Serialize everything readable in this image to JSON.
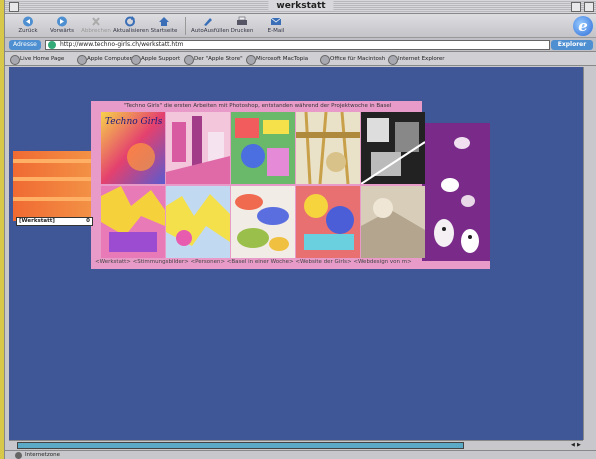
{
  "window": {
    "title": "werkstatt"
  },
  "toolbar": {
    "buttons": [
      {
        "label": "Zurück",
        "icon": "back-arrow-icon",
        "enabled": true
      },
      {
        "label": "Vorwärts",
        "icon": "forward-arrow-icon",
        "enabled": true
      },
      {
        "label": "Abbrechen",
        "icon": "stop-x-icon",
        "enabled": false
      },
      {
        "label": "Aktualisieren",
        "icon": "refresh-icon",
        "enabled": true
      },
      {
        "label": "Startseite",
        "icon": "home-icon",
        "enabled": true
      },
      {
        "label": "AutoAusfüllen",
        "icon": "autofill-pen-icon",
        "enabled": true
      },
      {
        "label": "Drucken",
        "icon": "printer-icon",
        "enabled": true
      },
      {
        "label": "E-Mail",
        "icon": "mail-icon",
        "enabled": true
      }
    ]
  },
  "address": {
    "label": "Adresse",
    "url": "http://www.techno-girls.ch/werkstatt.htm",
    "go_label": "Explorer"
  },
  "favorites": [
    "Live Home Page",
    "Apple Computer",
    "Apple Support",
    "Der \"Apple Store\"",
    "Microsoft MacTopia",
    "Office für Macintosh",
    "Internet Explorer"
  ],
  "page": {
    "caption_top": "\"Techno Girls\" die ersten Arbeiten mit Photoshop, entstanden während der Projektwoche in Basel",
    "caption_bottom": "<Werkstatt> <Stimmungsbilder> <Personen> <Basel in einer Woche> <Website der Girls> <Webdesign von m>",
    "banner_logo_text": "Techno Girls",
    "werkstatt_label": "[Werkstatt]",
    "werkstatt_num": "0"
  },
  "status": {
    "text": "Internetzone"
  },
  "colors": {
    "content_bg": "#3f5796",
    "pink_frame": "#e89bc8",
    "orange_banner": "#f06a32",
    "purple_panel": "#7a2b8a"
  }
}
